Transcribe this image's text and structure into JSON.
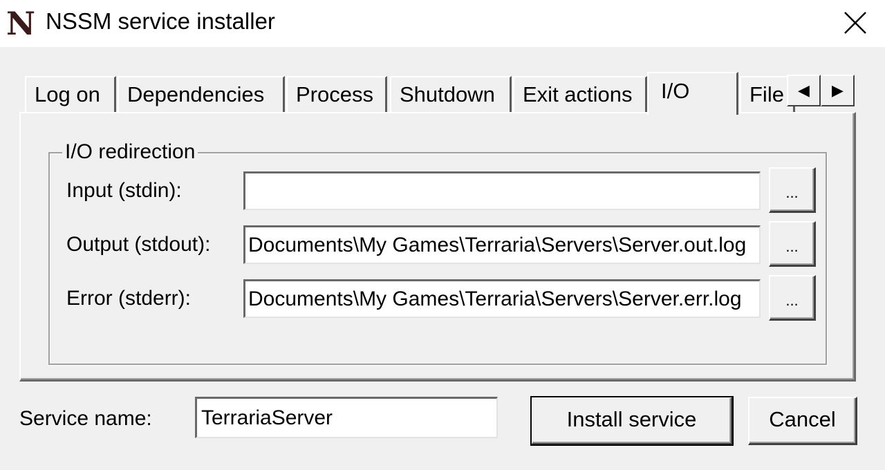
{
  "window": {
    "title": "NSSM service installer",
    "logo_letter": "N",
    "close_icon": "close-icon"
  },
  "tabs": [
    {
      "label": "Log on",
      "active": false
    },
    {
      "label": "Dependencies",
      "active": false
    },
    {
      "label": "Process",
      "active": false
    },
    {
      "label": "Shutdown",
      "active": false
    },
    {
      "label": "Exit actions",
      "active": false
    },
    {
      "label": "I/O",
      "active": true
    },
    {
      "label": "File",
      "active": false
    }
  ],
  "tab_scroll": {
    "left_icon": "◀",
    "right_icon": "▶"
  },
  "io_redirection": {
    "legend": "I/O redirection",
    "input": {
      "label": "Input (stdin):",
      "value": "",
      "browse_label": "..."
    },
    "output": {
      "label": "Output (stdout):",
      "value": "Documents\\My Games\\Terraria\\Servers\\Server.out.log",
      "browse_label": "..."
    },
    "error": {
      "label": "Error (stderr):",
      "value": "Documents\\My Games\\Terraria\\Servers\\Server.err.log",
      "browse_label": "..."
    }
  },
  "service": {
    "label": "Service name:",
    "value": "TerrariaServer",
    "install_label": "Install service",
    "cancel_label": "Cancel"
  },
  "colors": {
    "face": "#f0f0f0",
    "shadow": "#696969",
    "highlight": "#ffffff",
    "logo": "#3a1a1a"
  }
}
